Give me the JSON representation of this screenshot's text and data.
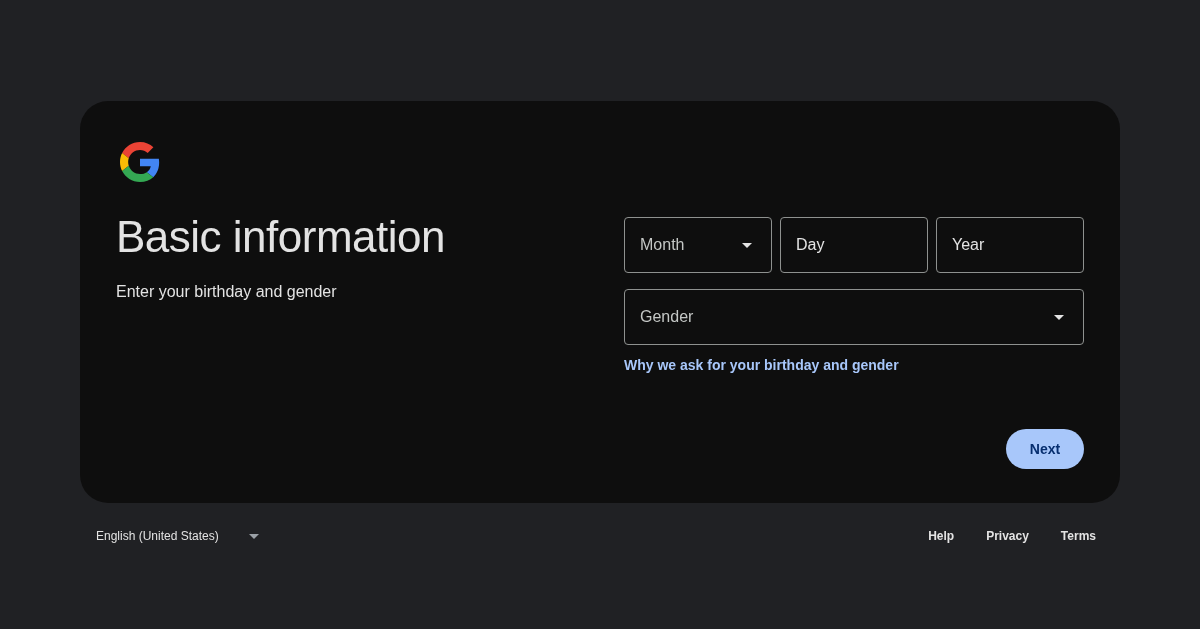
{
  "card": {
    "title": "Basic information",
    "subtitle": "Enter your birthday and gender",
    "date_fields": [
      {
        "kind": "select",
        "placeholder": "Month"
      },
      {
        "kind": "text",
        "placeholder": "Day"
      },
      {
        "kind": "text",
        "placeholder": "Year"
      }
    ],
    "gender_field": {
      "kind": "select",
      "placeholder": "Gender"
    },
    "help_link": "Why we ask for your birthday and gender",
    "next_button": "Next"
  },
  "footer": {
    "language": "English (United States)",
    "links": [
      "Help",
      "Privacy",
      "Terms"
    ]
  }
}
